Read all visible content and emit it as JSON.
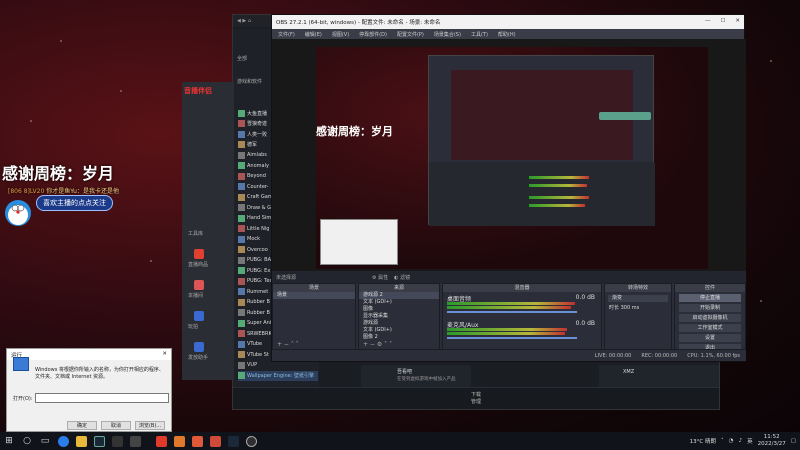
{
  "desktop": {
    "overlay_title": "感谢周榜：岁月",
    "chat_user": "[806 8]LV20",
    "chat_text": "你才是鱼Yu：是我卡还是他",
    "follow_text": "喜欢主播的点点关注"
  },
  "steam": {
    "header": "全部",
    "section": "游戏和软件",
    "games": [
      "大鱼直播",
      "雪狼奇迹",
      "人类一败",
      "德军",
      "Aimlabs",
      "Anomaly",
      "Beyond",
      "Counter-",
      "Craft Gam",
      "Draw & G",
      "Hand Sim",
      "Little Nig",
      "Mock",
      "Overcoo",
      "PUBG: BA",
      "PUBG: Ex",
      "PUBG: Tes",
      "Rummet",
      "Rubber B",
      "Rubber B",
      "Super Ani",
      "SRWEBRK",
      "VTube",
      "VTube St",
      "VUP",
      "Wallpaper Engine: 壁纸引擎"
    ],
    "download_label": "下载",
    "download_sub": "管理",
    "tile1_title": "吾看吧",
    "tile1_sub": "在受到虚拟游戏中帧加入产品",
    "tile2_title": "XMZ"
  },
  "yinghu": {
    "logo": "音播伴侣",
    "tools_label": "工具库",
    "items": [
      "直播商品",
      "本播间",
      "玩拍",
      "发放助手"
    ]
  },
  "obs": {
    "title": "OBS 27.2.1 (64-bit, windows) - 配置文件: 未命名 - 场景: 未命名",
    "menu": [
      "文件(F)",
      "编辑(E)",
      "视图(V)",
      "停靠部件(D)",
      "配置文件(P)",
      "场景集合(S)",
      "工具(T)",
      "帮助(H)"
    ],
    "context_label": "未选择源",
    "context_buttons": [
      "属性",
      "滤镜"
    ],
    "preview_text": "感谢周榜：岁月",
    "docks": {
      "scenes": {
        "title": "场景",
        "items": [
          "场景"
        ]
      },
      "sources": {
        "title": "来源",
        "items": [
          "游戏源 2",
          "文本 (GDI+)",
          "图像",
          "显示器采集",
          "游戏源",
          "文本 (GDI+)",
          "图像 2"
        ]
      },
      "mixer": {
        "title": "混音器",
        "tracks": [
          {
            "name": "桌面音频",
            "db": "0.0 dB"
          },
          {
            "name": "麦克风/Aux",
            "db": "0.0 dB"
          }
        ]
      },
      "transitions": {
        "title": "转场特效",
        "type": "渐变",
        "duration_label": "时长",
        "duration": "300 ms"
      },
      "controls": {
        "title": "控件",
        "buttons": [
          "停止直播",
          "开始录制",
          "启动虚拟摄像机",
          "工作室模式",
          "设置",
          "退出"
        ]
      }
    },
    "status": [
      "LIVE: 00:00:00",
      "REC: 00:00:00",
      "CPU: 1.1%, 60.00 fps"
    ]
  },
  "run_dialog": {
    "title": "运行",
    "description": "Windows 将根据你所输入的名称，为你打开相应的程序、文件夹、文档或 Internet 资源。",
    "open_label": "打开(O):",
    "buttons": [
      "确定",
      "取消",
      "浏览(B)..."
    ]
  },
  "taskbar": {
    "weather": "13°C 晴朗",
    "time": "11:52",
    "date": "2022/3/27",
    "lang": "英"
  },
  "colors": {
    "accent": "#e04030",
    "obs_bg": "#2b2e38",
    "live_green": "#2a9a2a"
  }
}
